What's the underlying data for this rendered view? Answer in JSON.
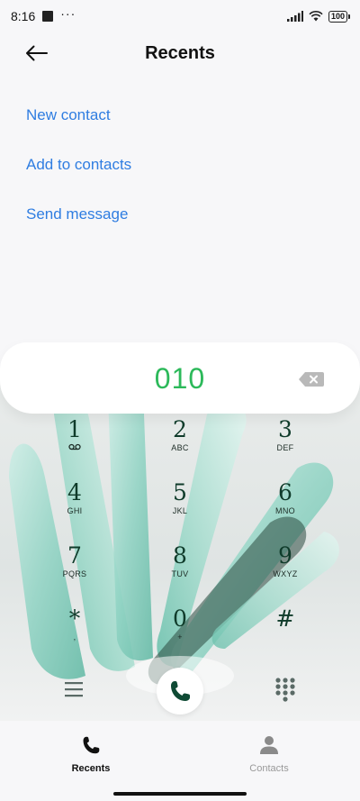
{
  "status_bar": {
    "time": "8:16",
    "dots": "···",
    "battery": "100"
  },
  "header": {
    "title": "Recents",
    "back_icon": "arrow-left-icon"
  },
  "actions": [
    {
      "label": "New contact"
    },
    {
      "label": "Add to contacts"
    },
    {
      "label": "Send message"
    }
  ],
  "dialer": {
    "number": "010",
    "number_color": "#2cb95a",
    "keys": [
      {
        "digit": "1",
        "letters": "◌"
      },
      {
        "digit": "2",
        "letters": "ABC"
      },
      {
        "digit": "3",
        "letters": "DEF"
      },
      {
        "digit": "4",
        "letters": "GHI"
      },
      {
        "digit": "5",
        "letters": "JKL"
      },
      {
        "digit": "6",
        "letters": "MNO"
      },
      {
        "digit": "7",
        "letters": "PQRS"
      },
      {
        "digit": "8",
        "letters": "TUV"
      },
      {
        "digit": "9",
        "letters": "WXYZ"
      },
      {
        "digit": "*",
        "letters": ","
      },
      {
        "digit": "0",
        "letters": "+"
      },
      {
        "digit": "#",
        "letters": ""
      }
    ]
  },
  "bottom_nav": {
    "items": [
      {
        "label": "Recents",
        "icon": "phone-icon",
        "active": true
      },
      {
        "label": "Contacts",
        "icon": "person-icon",
        "active": false
      }
    ]
  },
  "colors": {
    "link": "#2f7de1",
    "accent_green": "#2cb95a",
    "call_icon": "#0f4a34"
  }
}
